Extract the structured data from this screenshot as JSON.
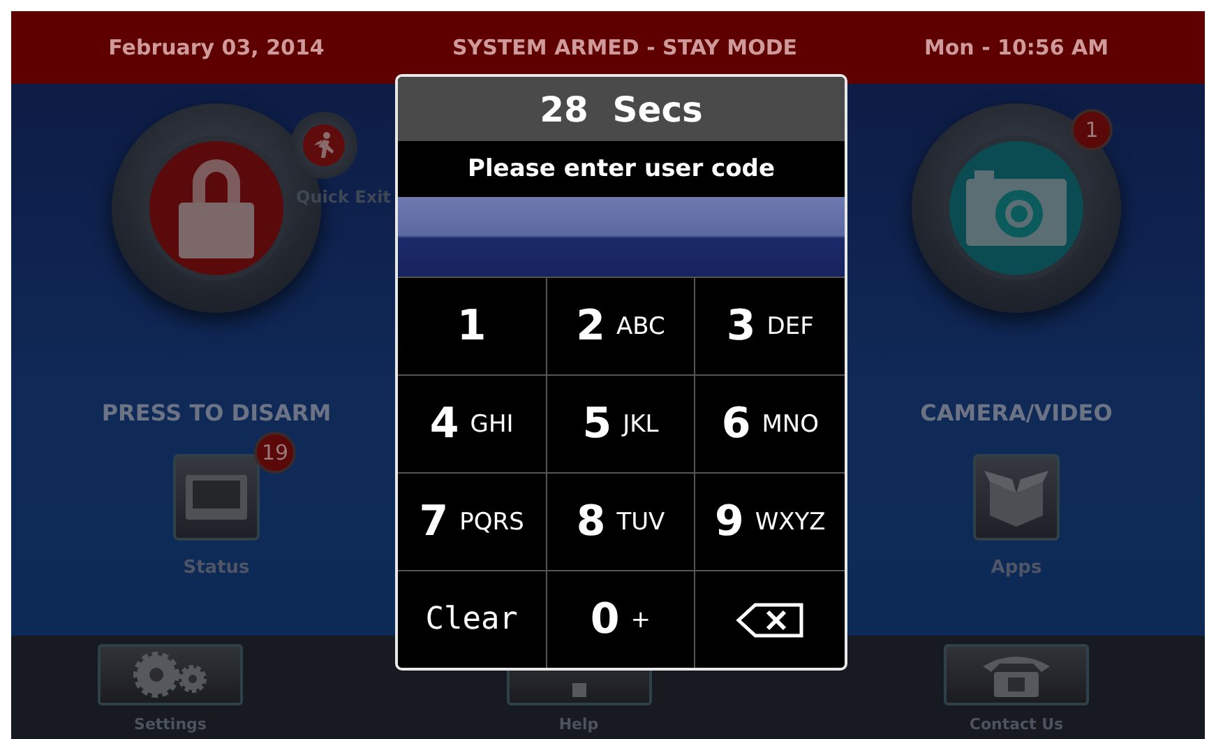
{
  "header": {
    "date": "February 03, 2014",
    "status": "SYSTEM ARMED - STAY MODE",
    "time": "Mon - 10:56 AM"
  },
  "main_buttons": [
    {
      "kind": "disarm",
      "label": "PRESS TO DISARM"
    },
    {
      "kind": "camera",
      "label": "CAMERA/VIDEO",
      "badge": "1"
    }
  ],
  "quick_exit": {
    "label": "Quick Exit"
  },
  "tiles": [
    {
      "kind": "status",
      "label": "Status",
      "badge": "19"
    },
    {
      "kind": "apps",
      "label": "Apps"
    }
  ],
  "bottom_bar": [
    {
      "kind": "settings",
      "label": "Settings"
    },
    {
      "kind": "help",
      "label": "Help"
    },
    {
      "kind": "contact",
      "label": "Contact Us"
    }
  ],
  "dialog": {
    "countdown": "28  Secs",
    "prompt": "Please enter user code",
    "keys": [
      {
        "kind": "digit",
        "digit": "1"
      },
      {
        "kind": "digit",
        "digit": "2",
        "letters": "ABC"
      },
      {
        "kind": "digit",
        "digit": "3",
        "letters": "DEF"
      },
      {
        "kind": "digit",
        "digit": "4",
        "letters": "GHI"
      },
      {
        "kind": "digit",
        "digit": "5",
        "letters": "JKL"
      },
      {
        "kind": "digit",
        "digit": "6",
        "letters": "MNO"
      },
      {
        "kind": "digit",
        "digit": "7",
        "letters": "PQRS"
      },
      {
        "kind": "digit",
        "digit": "8",
        "letters": "TUV"
      },
      {
        "kind": "digit",
        "digit": "9",
        "letters": "WXYZ"
      },
      {
        "kind": "clear",
        "label": "Clear"
      },
      {
        "kind": "digit",
        "digit": "0",
        "letters": "+"
      },
      {
        "kind": "backspace"
      }
    ]
  }
}
